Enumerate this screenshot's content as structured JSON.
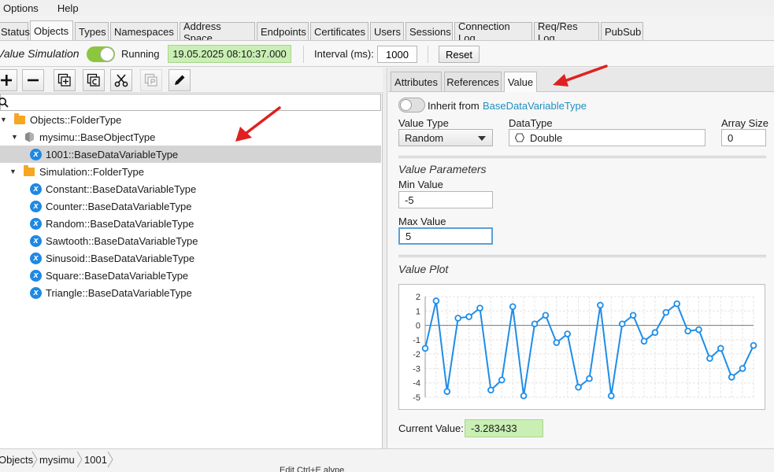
{
  "menu": [
    "Options",
    "Help"
  ],
  "tabs": [
    "Status",
    "Objects",
    "Types",
    "Namespaces",
    "Address Space",
    "Endpoints",
    "Certificates",
    "Users",
    "Sessions",
    "Connection Log",
    "Req/Res Log",
    "PubSub"
  ],
  "active_tab": "Objects",
  "toolbar": {
    "sim_label": "Value Simulation",
    "running_label": "Running",
    "timestamp": "19.05.2025 08:10:37.000",
    "interval_label": "Interval (ms):",
    "interval_value": "1000",
    "reset_label": "Reset"
  },
  "tree": {
    "nodes": [
      {
        "label": "Objects::FolderType"
      },
      {
        "label": "mysimu::BaseObjectType"
      },
      {
        "label": "1001::BaseDataVariableType"
      },
      {
        "label": "Simulation::FolderType"
      },
      {
        "label": "Constant::BaseDataVariableType"
      },
      {
        "label": "Counter::BaseDataVariableType"
      },
      {
        "label": "Random::BaseDataVariableType"
      },
      {
        "label": "Sawtooth::BaseDataVariableType"
      },
      {
        "label": "Sinusoid::BaseDataVariableType"
      },
      {
        "label": "Square::BaseDataVariableType"
      },
      {
        "label": "Triangle::BaseDataVariableType"
      }
    ]
  },
  "right_tabs": [
    "Attributes",
    "References",
    "Value"
  ],
  "active_right_tab": "Value",
  "value_panel": {
    "inherit_label": "Inherit from",
    "inherit_link": "BaseDataVariableType",
    "value_type_label": "Value Type",
    "value_type": "Random",
    "datatype_label": "DataType",
    "datatype": "Double",
    "array_size_label": "Array Size",
    "array_size": "0",
    "params_title": "Value Parameters",
    "min_label": "Min Value",
    "min_value": "-5",
    "max_label": "Max Value",
    "max_value": "5",
    "plot_title": "Value Plot",
    "current_label": "Current Value:",
    "current_value": "-3.283433"
  },
  "chart_data": {
    "type": "line",
    "ylim": [
      -5,
      2
    ],
    "yticks": [
      "2",
      "1",
      "0",
      "-1",
      "-2",
      "-3",
      "-4",
      "-5"
    ],
    "grid": true,
    "values": [
      -1.6,
      1.7,
      -4.6,
      0.5,
      0.6,
      1.2,
      -4.5,
      -3.8,
      1.3,
      -4.9,
      0.1,
      0.7,
      -1.2,
      -0.6,
      -4.3,
      -3.7,
      1.4,
      -4.9,
      0.1,
      0.7,
      -1.1,
      -0.5,
      0.9,
      1.5,
      -0.4,
      -0.3,
      -2.3,
      -1.6,
      -3.6,
      -3.0,
      -1.4
    ]
  },
  "breadcrumb": [
    "Objects",
    "mysimu",
    "1001"
  ],
  "bg_strip_text": "Edit            Ctrl+E   alype"
}
